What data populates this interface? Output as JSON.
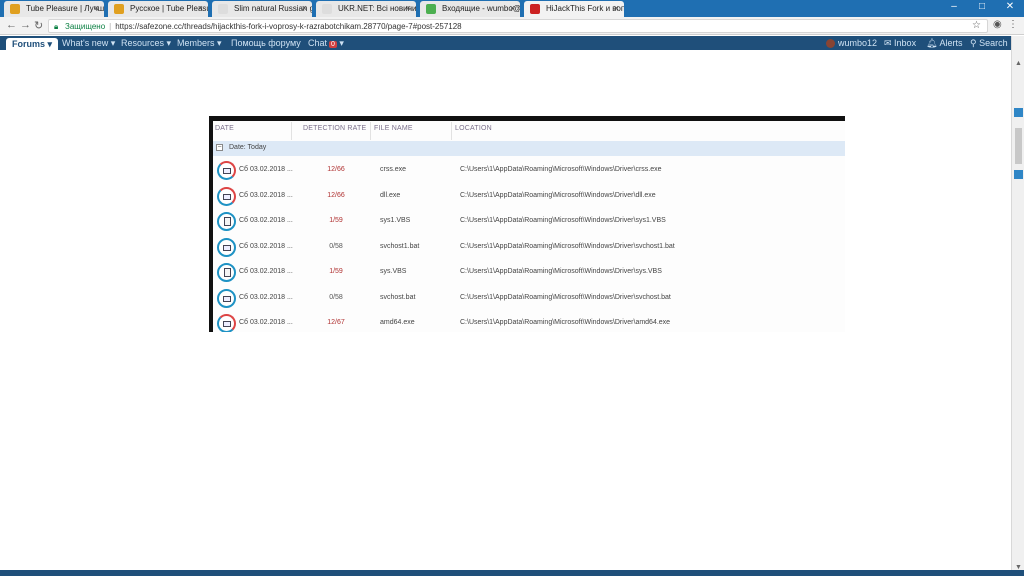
{
  "browser": {
    "tabs": [
      {
        "label": "Tube Pleasure | Лучшие",
        "favicon_color": "#e0a020"
      },
      {
        "label": "Русское | Tube Pleasure",
        "favicon_color": "#e0a020"
      },
      {
        "label": "Slim natural Russian girl",
        "favicon_color": "#dddddd"
      },
      {
        "label": "UKR.NET: Всі новини Ук",
        "favicon_color": "#dddddd"
      },
      {
        "label": "Входящие - wumbo@ur",
        "favicon_color": "#4caf50"
      },
      {
        "label": "HiJackThis Fork и вопро",
        "favicon_color": "#cc2222"
      }
    ],
    "close_glyph": "×",
    "window_controls": {
      "minimize": "–",
      "maximize": "□",
      "close": "✕"
    },
    "address": {
      "secure_label": "Защищено",
      "url": "https://safezone.cc/threads/hijackthis-fork-i-voprosy-k-razrabotchikam.28770/page-7#post-257128"
    }
  },
  "sitenav": {
    "items": [
      "Forums",
      "What's new",
      "Resources",
      "Members",
      "Помощь форуму",
      "Chat"
    ],
    "chat_badge": "0",
    "user": "wumbo12",
    "inbox": "Inbox",
    "alerts": "Alerts",
    "search": "Search"
  },
  "hjt": {
    "columns": [
      "DATE",
      "DETECTION RATE",
      "FILE NAME",
      "LOCATION"
    ],
    "group_label": "Date: Today",
    "group_toggle": "−",
    "rows": [
      {
        "date": "Сб 03.02.2018 ...",
        "rate": "12/66",
        "file": "crss.exe",
        "location": "C:\\Users\\1\\AppData\\Roaming\\Microsoft\\Windows\\Driver\\crss.exe",
        "icon": "exe",
        "flag": true
      },
      {
        "date": "Сб 03.02.2018 ...",
        "rate": "12/66",
        "file": "dll.exe",
        "location": "C:\\Users\\1\\AppData\\Roaming\\Microsoft\\Windows\\Driver\\dll.exe",
        "icon": "exe",
        "flag": true
      },
      {
        "date": "Сб 03.02.2018 ...",
        "rate": "1/59",
        "file": "sys1.VBS",
        "location": "C:\\Users\\1\\AppData\\Roaming\\Microsoft\\Windows\\Driver\\sys1.VBS",
        "icon": "doc",
        "flag": false
      },
      {
        "date": "Сб 03.02.2018 ...",
        "rate": "0/58",
        "file": "svchost1.bat",
        "location": "C:\\Users\\1\\AppData\\Roaming\\Microsoft\\Windows\\Driver\\svchost1.bat",
        "icon": "bat",
        "flag": false
      },
      {
        "date": "Сб 03.02.2018 ...",
        "rate": "1/59",
        "file": "sys.VBS",
        "location": "C:\\Users\\1\\AppData\\Roaming\\Microsoft\\Windows\\Driver\\sys.VBS",
        "icon": "doc",
        "flag": false
      },
      {
        "date": "Сб 03.02.2018 ...",
        "rate": "0/58",
        "file": "svchost.bat",
        "location": "C:\\Users\\1\\AppData\\Roaming\\Microsoft\\Windows\\Driver\\svchost.bat",
        "icon": "bat",
        "flag": false
      },
      {
        "date": "Сб 03.02.2018 ...",
        "rate": "12/67",
        "file": "amd64.exe",
        "location": "C:\\Users\\1\\AppData\\Roaming\\Microsoft\\Windows\\Driver\\amd64.exe",
        "icon": "exe",
        "flag": true
      }
    ]
  }
}
